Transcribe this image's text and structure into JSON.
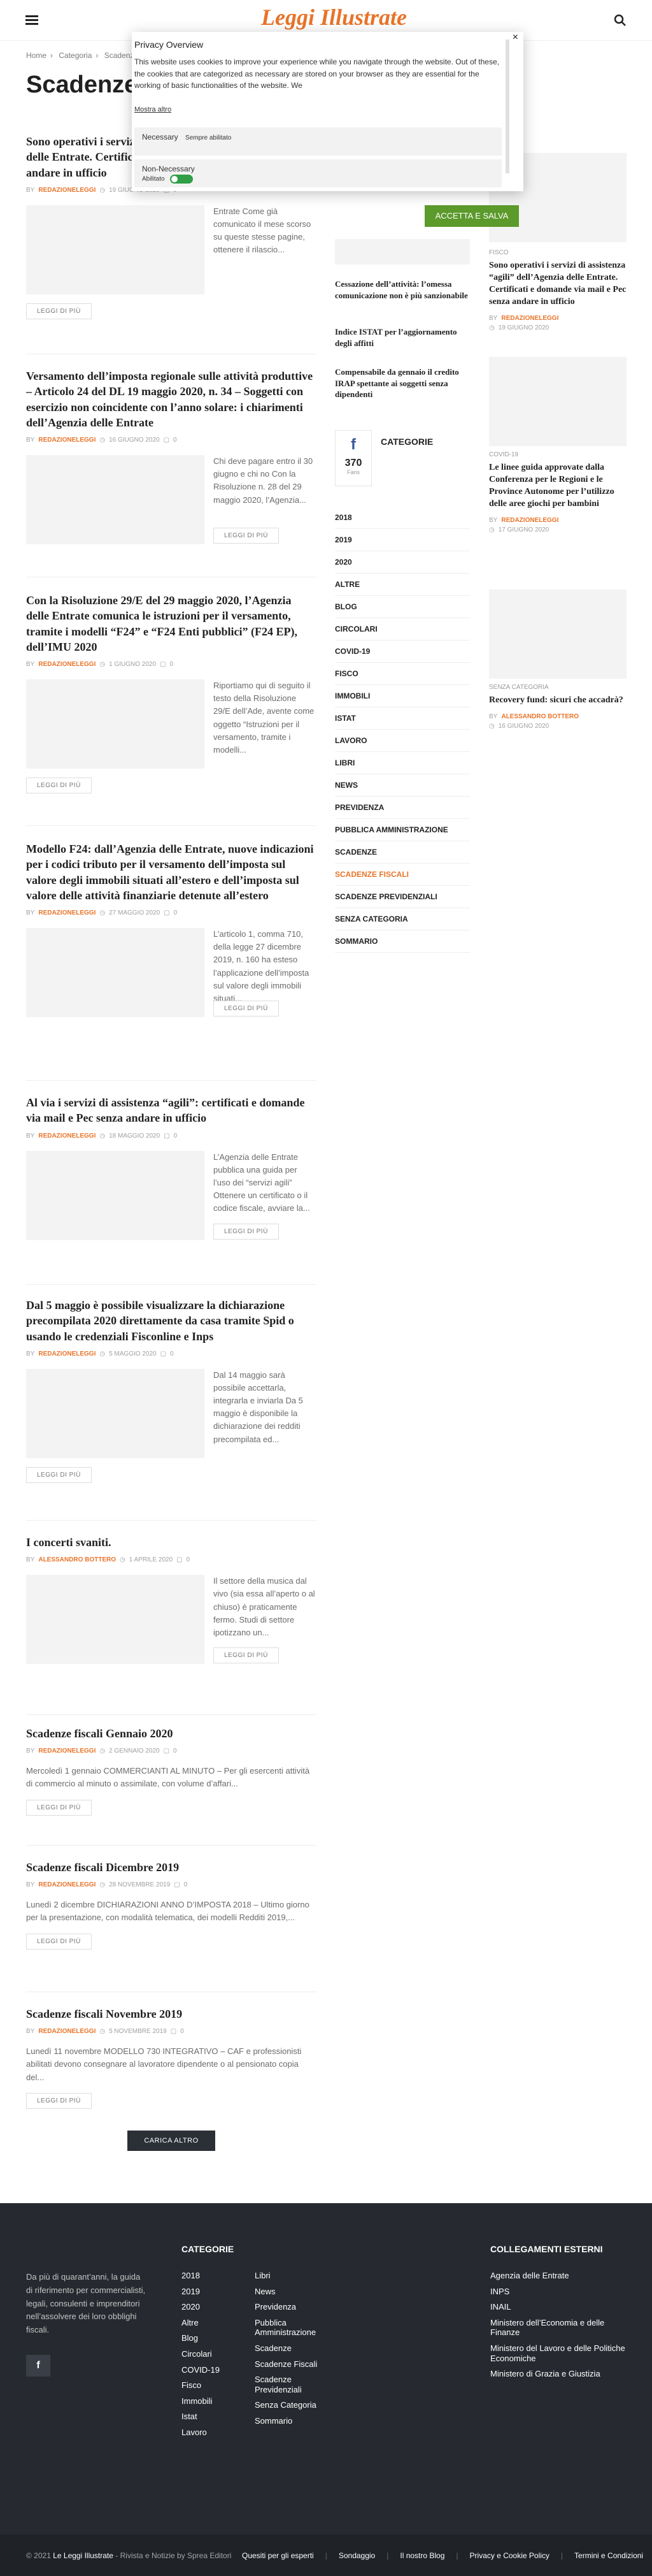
{
  "header": {
    "logo": "Leggi Illustrate"
  },
  "breadcrumb": {
    "home": "Home",
    "category": "Categoria",
    "current": "Scadenze Fiscali"
  },
  "page_title": "Scadenze Fiscali",
  "posts": [
    {
      "title": "Sono operativi i servizi di assistenza “agili” dell’Agenzia delle Entrate. Certificati e domande via mail e Pec senza andare in ufficio",
      "author": "REDAZIONELEGGI",
      "date": "19 GIUGNO 2020",
      "comments": "0",
      "excerpt": "Entrate Come già comunicato il mese scorso su queste stesse pagine, ottenere il rilascio...",
      "more": "LEGGI DI PIÙ"
    },
    {
      "title": "Versamento dell’imposta regionale sulle attività produttive – Articolo 24 del DL 19 maggio 2020, n. 34 – Soggetti con esercizio non coincidente con l’anno solare: i chiarimenti dell’Agenzia delle Entrate",
      "author": "REDAZIONELEGGI",
      "date": "16 GIUGNO 2020",
      "comments": "0",
      "excerpt": "Chi deve pagare entro il 30 giugno e chi no Con la Risoluzione n. 28 del 29 maggio 2020, l’Agenzia...",
      "more": "LEGGI DI PIÙ"
    },
    {
      "title": "Con la Risoluzione 29/E del 29 maggio 2020, l’Agenzia delle Entrate comunica le istruzioni per il versamento, tramite i modelli “F24” e “F24 Enti pubblici” (F24 EP), dell’IMU 2020",
      "author": "REDAZIONELEGGI",
      "date": "1 GIUGNO 2020",
      "comments": "0",
      "excerpt": "Riportiamo qui di seguito il testo della Risoluzione 29/E dell’Ade, avente come oggetto “Istruzioni per il versamento, tramite i modelli...",
      "more": "LEGGI DI PIÙ"
    },
    {
      "title": "Modello F24: dall’Agenzia delle Entrate, nuove indicazioni per i codici tributo per il versamento dell’imposta sul valore degli immobili situati all’estero e dell’imposta sul valore delle attività finanziarie detenute all’estero",
      "author": "REDAZIONELEGGI",
      "date": "27 MAGGIO 2020",
      "comments": "0",
      "excerpt": "L’articolo 1, comma 710, della legge 27 dicembre 2019, n. 160 ha esteso l’applicazione dell’imposta sul valore degli immobili situati...",
      "more": "LEGGI DI PIÙ"
    },
    {
      "title": "Al via i servizi di assistenza “agili”: certificati e domande via mail e Pec senza andare in ufficio",
      "author": "REDAZIONELEGGI",
      "date": "18 MAGGIO 2020",
      "comments": "0",
      "excerpt": "L’Agenzia delle Entrate pubblica una guida per l’uso dei “servizi agili” Ottenere un certificato o il codice fiscale, avviare la...",
      "more": "LEGGI DI PIÙ"
    },
    {
      "title": "Dal 5 maggio è possibile visualizzare la dichiarazione precompilata 2020 direttamente da casa tramite Spid o usando le credenziali Fisconline e Inps",
      "author": "REDAZIONELEGGI",
      "date": "5 MAGGIO 2020",
      "comments": "0",
      "excerpt": "Dal 14 maggio sarà possibile accettarla, integrarla e inviarla Da 5 maggio è disponibile la dichiarazione dei redditi precompilata ed...",
      "more": "LEGGI DI PIÙ"
    },
    {
      "title": "I concerti svaniti.",
      "author": "ALESSANDRO BOTTERO",
      "date": "1 APRILE 2020",
      "comments": "0",
      "excerpt": "Il settore della musica dal vivo (sia essa all’aperto o al chiuso) è praticamente fermo. Studi di settore ipotizzano un...",
      "more": "LEGGI DI PIÙ"
    },
    {
      "title": "Scadenze fiscali Gennaio 2020",
      "author": "REDAZIONELEGGI",
      "date": "2 GENNAIO 2020",
      "comments": "0",
      "excerpt": "Mercoledì 1 gennaio COMMERCIANTI AL MINUTO – Per gli esercenti attività di commercio al minuto o assimilate, con volume d’affari...",
      "more": "LEGGI DI PIÙ"
    },
    {
      "title": "Scadenze fiscali Dicembre 2019",
      "author": "REDAZIONELEGGI",
      "date": "28 NOVEMBRE 2019",
      "comments": "0",
      "excerpt": "Lunedì 2 dicembre DICHIARAZIONI ANNO D’IMPOSTA 2018 – Ultimo giorno per la presentazione, con modalità telematica, dei modelli Redditi 2019,...",
      "more": "LEGGI DI PIÙ"
    },
    {
      "title": "Scadenze fiscali Novembre 2019",
      "author": "REDAZIONELEGGI",
      "date": "5 NOVEMBRE 2019",
      "comments": "0",
      "excerpt": "Lunedì 11 novembre MODELLO 730 INTEGRATIVO – CAF e professionisti abilitati devono consegnare al lavoratore dipendente o al pensionato copia del...",
      "more": "LEGGI DI PIÙ"
    }
  ],
  "meta_by": "BY",
  "load_more": "CARICA ALTRO",
  "mid_links": [
    "Cessazione dell’attività: l’omessa comunicazione non è più sanzionabile",
    "Indice ISTAT per l’aggiornamento degli affitti",
    "Compensabile da gennaio il credito IRAP spettante ai soggetti senza dipendenti"
  ],
  "categories_widget": {
    "fb_icon": "f",
    "fb_count": "370",
    "fb_label": "Fans",
    "title": "CATEGORIE",
    "items": [
      "2018",
      "2019",
      "2020",
      "ALTRE",
      "BLOG",
      "CIRCOLARI",
      "COVID-19",
      "FISCO",
      "IMMOBILI",
      "ISTAT",
      "LAVORO",
      "LIBRI",
      "NEWS",
      "PREVIDENZA",
      "PUBBLICA AMMINISTRAZIONE",
      "SCADENZE",
      "SCADENZE FISCALI",
      "SCADENZE PREVIDENZIALI",
      "SENZA CATEGORIA",
      "SOMMARIO"
    ],
    "active": "SCADENZE FISCALI"
  },
  "right_posts": [
    {
      "tag": "FISCO",
      "title": "Sono operativi i servizi di assistenza “agili” dell’Agenzia delle Entrate. Certificati e domande via mail e Pec senza andare in ufficio",
      "author": "REDAZIONELEGGI",
      "date": "19 GIUGNO 2020"
    },
    {
      "tag": "COVID-19",
      "title": "Le linee guida approvate dalla Conferenza per le Regioni e le Province Autonome per l’utilizzo delle aree giochi per bambini",
      "author": "REDAZIONELEGGI",
      "date": "17 GIUGNO 2020"
    },
    {
      "tag": "SENZA CATEGORIA",
      "title": "Recovery fund: sicuri che accadrà?",
      "author": "ALESSANDRO BOTTERO",
      "date": "16 GIUGNO 2020"
    }
  ],
  "cookie": {
    "title": "Privacy Overview",
    "text": "This website uses cookies to improve your experience while you navigate through the website. Out of these, the cookies that are categorized as necessary are stored on your browser as they are essential for the working of basic functionalities of the website. We",
    "more": "Mostra altro",
    "necessary": "Necessary",
    "necessary_status": "Sempre abilitato",
    "non_necessary": "Non-Necessary",
    "non_necessary_status": "Abilitato",
    "accept": "ACCETTA E SALVA",
    "close": "×"
  },
  "footer": {
    "about": "Da più di quarant’anni, la guida di riferimento per commercialisti, legali, consulenti e imprenditori nell’assolvere dei loro obblighi fiscali.",
    "fb": "f",
    "categories_title": "CATEGORIE",
    "col1": [
      "2018",
      "2019",
      "2020",
      "Altre",
      "Blog",
      "Circolari",
      "COVID-19",
      "Fisco",
      "Immobili",
      "Istat",
      "Lavoro"
    ],
    "col2": [
      "Libri",
      "News",
      "Previdenza",
      "Pubblica Amministrazione",
      "Scadenze",
      "Scadenze Fiscali",
      "Scadenze Previdenziali",
      "Senza Categoria",
      "Sommario"
    ],
    "links_title": "COLLEGAMENTI ESTERNI",
    "links": [
      "Agenzia delle Entrate",
      "INPS",
      "INAIL",
      "Ministero dell’Economia e delle Finanze",
      "Ministero del Lavoro e delle Politiche Economiche",
      "Ministero di Grazia e Giustizia"
    ],
    "copyright_prefix": "© 2021",
    "copyright_site": "Le Leggi Illustrate",
    "copyright_suffix": "- Rivista e Notizie by Sprea Editori",
    "bottom_links": [
      "Quesiti per gli esperti",
      "Sondaggio",
      "Il nostro Blog",
      "Privacy e Cookie Policy",
      "Termini e Condizioni"
    ]
  }
}
